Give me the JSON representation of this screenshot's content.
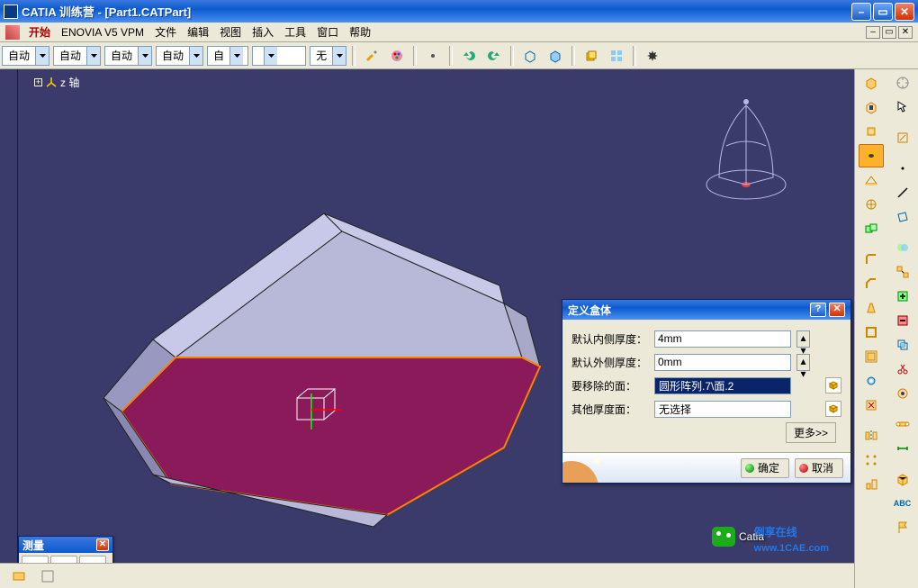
{
  "title": "CATIA 训练营 - [Part1.CATPart]",
  "menu": {
    "start": "开始",
    "items": [
      "ENOVIA V5 VPM",
      "文件",
      "编辑",
      "视图",
      "插入",
      "工具",
      "窗口",
      "帮助"
    ]
  },
  "combos": {
    "c1": "自动",
    "c2": "自动",
    "c3": "自动",
    "c4": "自动",
    "c5": "自",
    "c6": "",
    "c7": "无"
  },
  "tree": {
    "axis_label": "z 轴"
  },
  "watermark": "1CAE.COM",
  "watermark2_a": "Catia",
  "watermark2_b": "例享在线",
  "sitewm": "www.1CAE.com",
  "measure_palette": {
    "title": "测量"
  },
  "dialog": {
    "title": "定义盒体",
    "row1_label": "默认内侧厚度：",
    "row1_value": "4mm",
    "row2_label": "默认外侧厚度：",
    "row2_value": "0mm",
    "row3_label": "要移除的面：",
    "row3_value": "圆形阵列.7\\面.2",
    "row4_label": "其他厚度面：",
    "row4_value": "无选择",
    "more": "更多>>",
    "ok": "确定",
    "cancel": "取消"
  }
}
